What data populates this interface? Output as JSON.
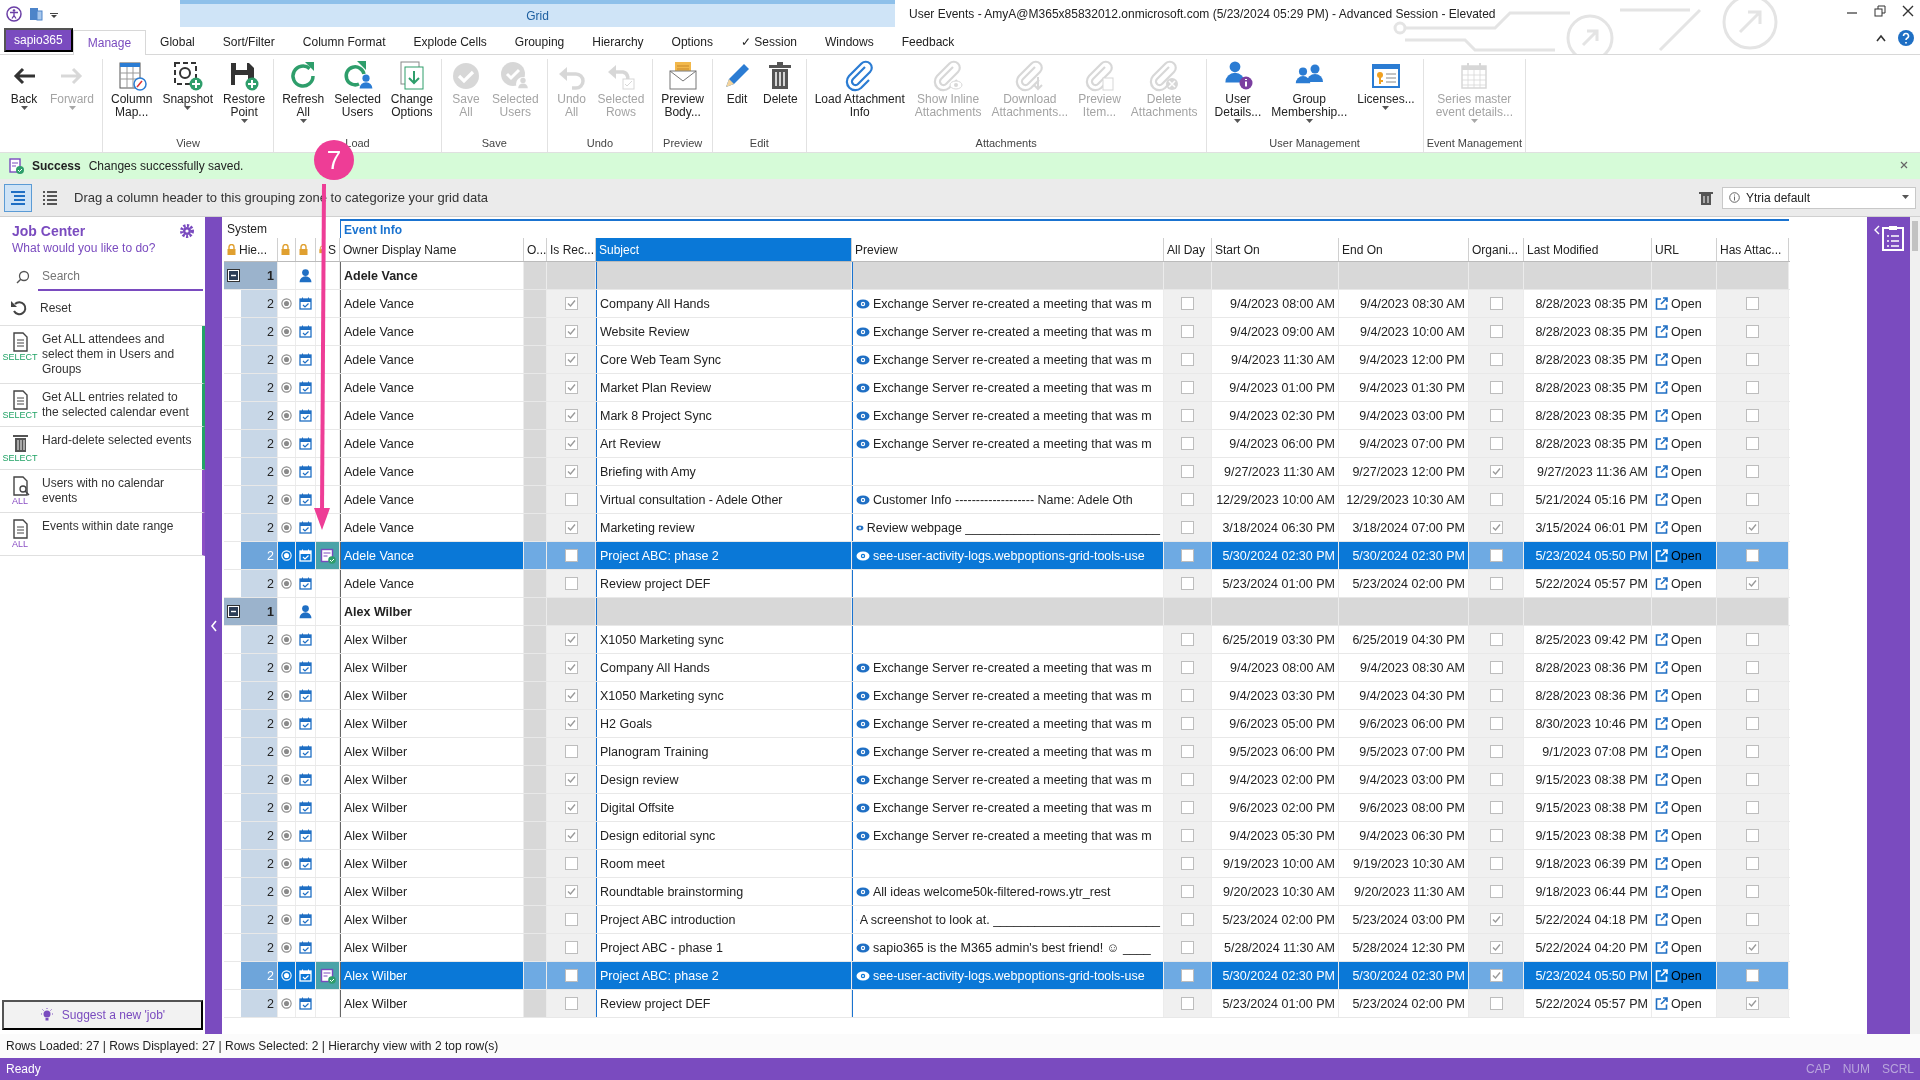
{
  "title_bar": {
    "context_tab": "Grid",
    "title": "User Events - AmyA@M365x85832012.onmicrosoft.com (5/23/2024 05:29 PM) - Advanced Session - Elevated"
  },
  "menu": {
    "app_button": "sapio365",
    "tabs": [
      {
        "label": "Manage",
        "selected": true
      },
      {
        "label": "Global",
        "selected": false
      },
      {
        "label": "Sort/Filter",
        "selected": false
      },
      {
        "label": "Column Format",
        "selected": false
      },
      {
        "label": "Explode Cells",
        "selected": false
      },
      {
        "label": "Grouping",
        "selected": false
      },
      {
        "label": "Hierarchy",
        "selected": false
      },
      {
        "label": "Options",
        "selected": false
      },
      {
        "label": "✓ Session",
        "selected": false
      },
      {
        "label": "Windows",
        "selected": false
      },
      {
        "label": "Feedback",
        "selected": false
      }
    ]
  },
  "ribbon": [
    {
      "buttons": [
        {
          "lines": [
            "Back"
          ],
          "disabled": false,
          "dropdown": true
        },
        {
          "lines": [
            "Forward"
          ],
          "disabled": true,
          "dropdown": true
        }
      ]
    },
    {
      "group": "View",
      "buttons": [
        {
          "lines": [
            "Column",
            "Map..."
          ],
          "disabled": false,
          "dropdown": false
        },
        {
          "lines": [
            "Snapshot"
          ],
          "disabled": false,
          "dropdown": true
        },
        {
          "lines": [
            "Restore",
            "Point"
          ],
          "disabled": false,
          "dropdown": true
        }
      ]
    },
    {
      "group": "Load",
      "buttons": [
        {
          "lines": [
            "Refresh",
            "All"
          ],
          "disabled": false,
          "dropdown": true
        },
        {
          "lines": [
            "Selected",
            "Users"
          ],
          "disabled": false,
          "dropdown": false
        },
        {
          "lines": [
            "Change",
            "Options"
          ],
          "disabled": false,
          "dropdown": false
        }
      ]
    },
    {
      "group": "Save",
      "buttons": [
        {
          "lines": [
            "Save",
            "All"
          ],
          "disabled": true,
          "dropdown": false
        },
        {
          "lines": [
            "Selected",
            "Users"
          ],
          "disabled": true,
          "dropdown": false
        }
      ]
    },
    {
      "group": "Undo",
      "buttons": [
        {
          "lines": [
            "Undo",
            "All"
          ],
          "disabled": true,
          "dropdown": false
        },
        {
          "lines": [
            "Selected",
            "Rows"
          ],
          "disabled": true,
          "dropdown": false
        }
      ]
    },
    {
      "group": "Preview",
      "buttons": [
        {
          "lines": [
            "Preview",
            "Body..."
          ],
          "disabled": false,
          "dropdown": false
        }
      ]
    },
    {
      "group": "Edit",
      "buttons": [
        {
          "lines": [
            "Edit"
          ],
          "disabled": false,
          "dropdown": false
        },
        {
          "lines": [
            "Delete"
          ],
          "disabled": false,
          "dropdown": false
        }
      ]
    },
    {
      "group": "Attachments",
      "buttons": [
        {
          "lines": [
            "Load Attachment",
            "Info"
          ],
          "disabled": false,
          "dropdown": false
        },
        {
          "lines": [
            "Show Inline",
            "Attachments"
          ],
          "disabled": true,
          "dropdown": false
        },
        {
          "lines": [
            "Download",
            "Attachments..."
          ],
          "disabled": true,
          "dropdown": false
        },
        {
          "lines": [
            "Preview",
            "Item..."
          ],
          "disabled": true,
          "dropdown": false
        },
        {
          "lines": [
            "Delete",
            "Attachments"
          ],
          "disabled": true,
          "dropdown": false
        }
      ]
    },
    {
      "group": "User Management",
      "buttons": [
        {
          "lines": [
            "User",
            "Details..."
          ],
          "disabled": false,
          "dropdown": true
        },
        {
          "lines": [
            "Group",
            "Membership..."
          ],
          "disabled": false,
          "dropdown": true
        },
        {
          "lines": [
            "Licenses..."
          ],
          "disabled": false,
          "dropdown": true
        }
      ]
    },
    {
      "group": "Event Management",
      "buttons": [
        {
          "lines": [
            "Series master",
            "event details..."
          ],
          "disabled": true,
          "dropdown": true
        }
      ]
    }
  ],
  "notification": {
    "title": "Success",
    "message": "Changes successfully saved."
  },
  "annotation": {
    "label": "7"
  },
  "grouping_zone": {
    "view_buttons": [
      {
        "selected": true
      },
      {
        "selected": false
      }
    ],
    "hint": "Drag a column header to this grouping zone to categorize your grid data",
    "layout": "Ytria default"
  },
  "job_center": {
    "title": "Job Center",
    "subtitle": "What would you like to do?",
    "search": {
      "placeholder": "Search"
    },
    "reset": "Reset",
    "jobs": [
      {
        "label": "Get ALL attendees and select them in Users and Groups",
        "tag": "SELECT",
        "color": "#21a366"
      },
      {
        "label": "Get ALL entries related to the selected calendar event",
        "tag": "SELECT",
        "color": "#21a366"
      },
      {
        "label": "Hard-delete selected events",
        "tag": "SELECT",
        "color": "#21a366"
      },
      {
        "label": "Users with no calendar events",
        "tag": "ALL",
        "color": "#8a4fc4"
      },
      {
        "label": "Events within date range",
        "tag": "ALL",
        "color": "#8a4fc4"
      }
    ],
    "suggest": "Suggest a new 'job'"
  },
  "grid": {
    "bands": [
      {
        "label": "System"
      },
      {
        "label": "Event Info"
      }
    ],
    "columns": [
      {
        "label": "Hie...",
        "locked": true,
        "selected": false
      },
      {
        "locked": true,
        "selected": false
      },
      {
        "locked": true,
        "selected": false
      },
      {
        "label": "S",
        "locked": true,
        "selected": false
      },
      {
        "label": "Owner Display Name",
        "locked": false,
        "selected": false
      },
      {
        "label": "O...",
        "locked": false,
        "selected": false
      },
      {
        "label": "Is Rec...",
        "locked": false,
        "selected": false
      },
      {
        "label": "Subject",
        "locked": false,
        "selected": true
      },
      {
        "label": "Preview",
        "locked": false,
        "selected": false
      },
      {
        "label": "All Day",
        "locked": false,
        "selected": false
      },
      {
        "label": "Start On",
        "locked": false,
        "selected": false
      },
      {
        "label": "End On",
        "locked": false,
        "selected": false
      },
      {
        "label": "Organi...",
        "locked": false,
        "selected": false
      },
      {
        "label": "Last Modified",
        "locked": false,
        "selected": false
      },
      {
        "label": "URL",
        "locked": false,
        "selected": false
      },
      {
        "label": "Has Attac...",
        "locked": false,
        "selected": false
      }
    ],
    "groups": [
      {
        "level": "1",
        "owner": "Adele Vance",
        "expanded": true,
        "rows": [
          {
            "level": "2",
            "selected": false,
            "modified": false,
            "owner": "Adele Vance",
            "recurring": true,
            "subject": "Company All Hands",
            "preview": "Exchange Server re-created a meeting that was m",
            "all_day": false,
            "start": "9/4/2023 08:00 AM",
            "end": "9/4/2023 08:30 AM",
            "organizer": false,
            "last_modified": "8/28/2023 08:35 PM",
            "url": "Open",
            "attachments": false
          },
          {
            "level": "2",
            "selected": false,
            "modified": false,
            "owner": "Adele Vance",
            "recurring": true,
            "subject": "Website Review",
            "preview": "Exchange Server re-created a meeting that was m",
            "all_day": false,
            "start": "9/4/2023 09:00 AM",
            "end": "9/4/2023 10:00 AM",
            "organizer": false,
            "last_modified": "8/28/2023 08:35 PM",
            "url": "Open",
            "attachments": false
          },
          {
            "level": "2",
            "selected": false,
            "modified": false,
            "owner": "Adele Vance",
            "recurring": true,
            "subject": "Core Web Team Sync",
            "preview": "Exchange Server re-created a meeting that was m",
            "all_day": false,
            "start": "9/4/2023 11:30 AM",
            "end": "9/4/2023 12:00 PM",
            "organizer": false,
            "last_modified": "8/28/2023 08:35 PM",
            "url": "Open",
            "attachments": false
          },
          {
            "level": "2",
            "selected": false,
            "modified": false,
            "owner": "Adele Vance",
            "recurring": true,
            "subject": "Market Plan Review",
            "preview": "Exchange Server re-created a meeting that was m",
            "all_day": false,
            "start": "9/4/2023 01:00 PM",
            "end": "9/4/2023 01:30 PM",
            "organizer": false,
            "last_modified": "8/28/2023 08:35 PM",
            "url": "Open",
            "attachments": false
          },
          {
            "level": "2",
            "selected": false,
            "modified": false,
            "owner": "Adele Vance",
            "recurring": true,
            "subject": "Mark 8 Project Sync",
            "preview": "Exchange Server re-created a meeting that was m",
            "all_day": false,
            "start": "9/4/2023 02:30 PM",
            "end": "9/4/2023 03:00 PM",
            "organizer": false,
            "last_modified": "8/28/2023 08:35 PM",
            "url": "Open",
            "attachments": false
          },
          {
            "level": "2",
            "selected": false,
            "modified": false,
            "owner": "Adele Vance",
            "recurring": true,
            "subject": "Art Review",
            "preview": "Exchange Server re-created a meeting that was m",
            "all_day": false,
            "start": "9/4/2023 06:00 PM",
            "end": "9/4/2023 07:00 PM",
            "organizer": false,
            "last_modified": "8/28/2023 08:35 PM",
            "url": "Open",
            "attachments": false
          },
          {
            "level": "2",
            "selected": false,
            "modified": false,
            "owner": "Adele Vance",
            "recurring": true,
            "subject": "Briefing with Amy",
            "all_day": false,
            "start": "9/27/2023 11:30 AM",
            "end": "9/27/2023 12:00 PM",
            "organizer": true,
            "last_modified": "9/27/2023 11:36 AM",
            "url": "Open",
            "attachments": false
          },
          {
            "level": "2",
            "selected": false,
            "modified": false,
            "owner": "Adele Vance",
            "recurring": false,
            "subject": "Virtual consultation - Adele Other",
            "preview": "Customer Info ------------------- Name: Adele Oth",
            "all_day": false,
            "start": "12/29/2023 10:00 AM",
            "end": "12/29/2023 10:30 AM",
            "organizer": false,
            "last_modified": "5/21/2024 05:16 PM",
            "url": "Open",
            "attachments": false
          },
          {
            "level": "2",
            "selected": false,
            "modified": false,
            "owner": "Adele Vance",
            "recurring": true,
            "subject": "Marketing review",
            "preview": "Review webpage ____________________________",
            "all_day": false,
            "start": "3/18/2024 06:30 PM",
            "end": "3/18/2024 07:00 PM",
            "organizer": true,
            "last_modified": "3/15/2024 06:01 PM",
            "url": "Open",
            "attachments": true
          },
          {
            "level": "2",
            "selected": true,
            "modified": true,
            "owner": "Adele Vance",
            "recurring": false,
            "subject": "Project ABC: phase 2",
            "preview": "see-user-activity-logs.webpoptions-grid-tools-use",
            "all_day": false,
            "start": "5/30/2024 02:30 PM",
            "end": "5/30/2024 02:30 PM",
            "organizer": false,
            "last_modified": "5/23/2024 05:50 PM",
            "url": "Open",
            "attachments": false
          },
          {
            "level": "2",
            "selected": false,
            "modified": false,
            "owner": "Adele Vance",
            "recurring": false,
            "subject": "Review project DEF",
            "all_day": false,
            "start": "5/23/2024 01:00 PM",
            "end": "5/23/2024 02:00 PM",
            "organizer": false,
            "last_modified": "5/22/2024 05:57 PM",
            "url": "Open",
            "attachments": true
          }
        ]
      },
      {
        "level": "1",
        "owner": "Alex Wilber",
        "expanded": true,
        "rows": [
          {
            "level": "2",
            "selected": false,
            "modified": false,
            "owner": "Alex Wilber",
            "recurring": true,
            "subject": "X1050 Marketing sync",
            "all_day": false,
            "start": "6/25/2019 03:30 PM",
            "end": "6/25/2019 04:30 PM",
            "organizer": false,
            "last_modified": "8/25/2023 09:42 PM",
            "url": "Open",
            "attachments": false
          },
          {
            "level": "2",
            "selected": false,
            "modified": false,
            "owner": "Alex Wilber",
            "recurring": true,
            "subject": "Company All Hands",
            "preview": "Exchange Server re-created a meeting that was m",
            "all_day": false,
            "start": "9/4/2023 08:00 AM",
            "end": "9/4/2023 08:30 AM",
            "organizer": false,
            "last_modified": "8/28/2023 08:36 PM",
            "url": "Open",
            "attachments": false
          },
          {
            "level": "2",
            "selected": false,
            "modified": false,
            "owner": "Alex Wilber",
            "recurring": true,
            "subject": "X1050 Marketing sync",
            "preview": "Exchange Server re-created a meeting that was m",
            "all_day": false,
            "start": "9/4/2023 03:30 PM",
            "end": "9/4/2023 04:30 PM",
            "organizer": false,
            "last_modified": "8/28/2023 08:36 PM",
            "url": "Open",
            "attachments": false
          },
          {
            "level": "2",
            "selected": false,
            "modified": false,
            "owner": "Alex Wilber",
            "recurring": true,
            "subject": "H2 Goals",
            "preview": "Exchange Server re-created a meeting that was m",
            "all_day": false,
            "start": "9/6/2023 05:00 PM",
            "end": "9/6/2023 06:00 PM",
            "organizer": false,
            "last_modified": "8/30/2023 10:46 PM",
            "url": "Open",
            "attachments": false
          },
          {
            "level": "2",
            "selected": false,
            "modified": false,
            "owner": "Alex Wilber",
            "recurring": false,
            "subject": "Planogram Training",
            "preview": "Exchange Server re-created a meeting that was m",
            "all_day": false,
            "start": "9/5/2023 06:00 PM",
            "end": "9/5/2023 07:00 PM",
            "organizer": false,
            "last_modified": "9/1/2023 07:08 PM",
            "url": "Open",
            "attachments": false
          },
          {
            "level": "2",
            "selected": false,
            "modified": false,
            "owner": "Alex Wilber",
            "recurring": true,
            "subject": "Design review",
            "preview": "Exchange Server re-created a meeting that was m",
            "all_day": false,
            "start": "9/4/2023 02:00 PM",
            "end": "9/4/2023 03:00 PM",
            "organizer": false,
            "last_modified": "9/15/2023 08:38 PM",
            "url": "Open",
            "attachments": false
          },
          {
            "level": "2",
            "selected": false,
            "modified": false,
            "owner": "Alex Wilber",
            "recurring": true,
            "subject": "Digital Offsite",
            "preview": "Exchange Server re-created a meeting that was m",
            "all_day": false,
            "start": "9/6/2023 02:00 PM",
            "end": "9/6/2023 08:00 PM",
            "organizer": false,
            "last_modified": "9/15/2023 08:38 PM",
            "url": "Open",
            "attachments": false
          },
          {
            "level": "2",
            "selected": false,
            "modified": false,
            "owner": "Alex Wilber",
            "recurring": true,
            "subject": "Design editorial sync",
            "preview": "Exchange Server re-created a meeting that was m",
            "all_day": false,
            "start": "9/4/2023 05:30 PM",
            "end": "9/4/2023 06:30 PM",
            "organizer": false,
            "last_modified": "9/15/2023 08:38 PM",
            "url": "Open",
            "attachments": false
          },
          {
            "level": "2",
            "selected": false,
            "modified": false,
            "owner": "Alex Wilber",
            "recurring": false,
            "subject": "Room meet",
            "all_day": false,
            "start": "9/19/2023 10:00 AM",
            "end": "9/19/2023 10:30 AM",
            "organizer": false,
            "last_modified": "9/18/2023 06:39 PM",
            "url": "Open",
            "attachments": false
          },
          {
            "level": "2",
            "selected": false,
            "modified": false,
            "owner": "Alex Wilber",
            "recurring": true,
            "subject": "Roundtable brainstorming",
            "preview": "All ideas welcome50k-filtered-rows.ytr_rest",
            "all_day": false,
            "start": "9/20/2023 10:30 AM",
            "end": "9/20/2023 11:30 AM",
            "organizer": false,
            "last_modified": "9/18/2023 06:44 PM",
            "url": "Open",
            "attachments": false
          },
          {
            "level": "2",
            "selected": false,
            "modified": false,
            "owner": "Alex Wilber",
            "recurring": false,
            "subject": "Project ABC introduction",
            "preview": "A screenshot to look at. ________________________",
            "all_day": false,
            "start": "5/23/2024 02:00 PM",
            "end": "5/23/2024 03:00 PM",
            "organizer": true,
            "last_modified": "5/22/2024 04:18 PM",
            "url": "Open",
            "attachments": false
          },
          {
            "level": "2",
            "selected": false,
            "modified": false,
            "owner": "Alex Wilber",
            "recurring": false,
            "subject": "Project ABC - phase 1",
            "preview": "sapio365 is the M365 admin's best friend! ☺ ____",
            "all_day": false,
            "start": "5/28/2024 11:30 AM",
            "end": "5/28/2024 12:30 PM",
            "organizer": true,
            "last_modified": "5/22/2024 04:20 PM",
            "url": "Open",
            "attachments": true
          },
          {
            "level": "2",
            "selected": true,
            "modified": true,
            "owner": "Alex Wilber",
            "recurring": false,
            "subject": "Project ABC: phase 2",
            "preview": "see-user-activity-logs.webpoptions-grid-tools-use",
            "all_day": false,
            "start": "5/30/2024 02:30 PM",
            "end": "5/30/2024 02:30 PM",
            "organizer": true,
            "last_modified": "5/23/2024 05:50 PM",
            "url": "Open",
            "attachments": false
          },
          {
            "level": "2",
            "selected": false,
            "modified": false,
            "owner": "Alex Wilber",
            "recurring": false,
            "subject": "Review project DEF",
            "all_day": false,
            "start": "5/23/2024 01:00 PM",
            "end": "5/23/2024 02:00 PM",
            "organizer": false,
            "last_modified": "5/22/2024 05:57 PM",
            "url": "Open",
            "attachments": true
          }
        ]
      }
    ]
  },
  "status_line": "Rows Loaded: 27 | Rows Displayed: 27 | Rows Selected: 2 | Hierarchy view with 2 top row(s)",
  "status_bar": {
    "text": "Ready",
    "indicators": [
      "CAP",
      "NUM",
      "SCRL"
    ]
  }
}
